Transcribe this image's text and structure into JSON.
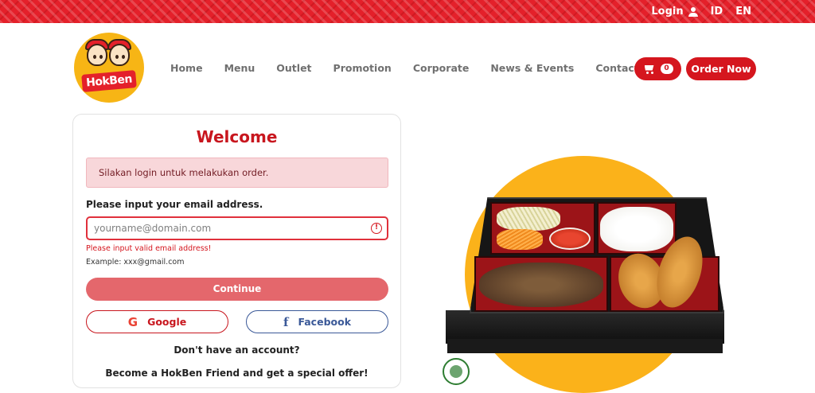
{
  "topbar": {
    "login_label": "Login",
    "lang_id": "ID",
    "lang_en": "EN"
  },
  "brand": {
    "logo_text": "HokBen"
  },
  "nav": {
    "items": [
      "Home",
      "Menu",
      "Outlet",
      "Promotion",
      "Corporate",
      "News & Events",
      "Contact Us"
    ]
  },
  "cart": {
    "count": "0",
    "icon": "shopping-cart-icon"
  },
  "order_button": "Order Now",
  "login_form": {
    "title": "Welcome",
    "alert": "Silakan login untuk melakukan order.",
    "email_label": "Please input your email address.",
    "email_placeholder": "yourname@domain.com",
    "email_value": "",
    "error": "Please input valid email address!",
    "example": "Example: xxx@gmail.com",
    "continue_label": "Continue",
    "google_label": "Google",
    "google_icon": "G",
    "facebook_label": "Facebook",
    "facebook_icon": "f",
    "no_account": "Don't have an account?",
    "promo": "Become a HokBen Friend and get a special offer!"
  },
  "colors": {
    "brand_red": "#d5161e",
    "accent_yellow": "#fbb21a",
    "alert_bg": "#f8d7da",
    "continue_bg": "#e4676c",
    "facebook_blue": "#3b5998"
  }
}
